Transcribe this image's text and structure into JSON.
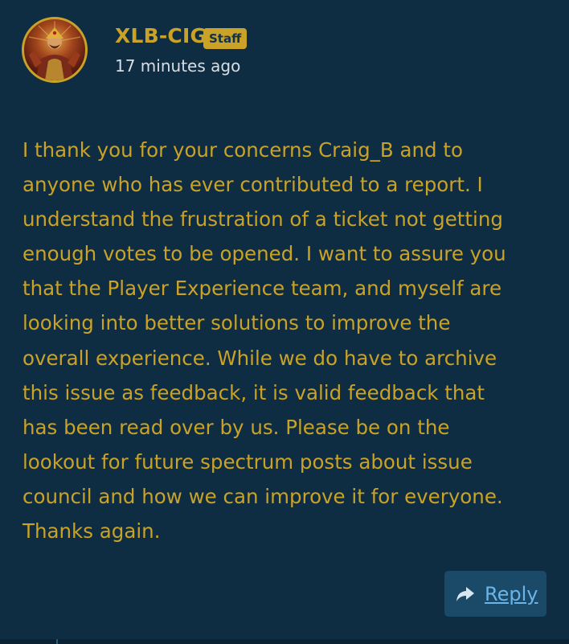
{
  "post": {
    "author": "XLB-CIG",
    "badge": "Staff",
    "timestamp": "17 minutes ago",
    "avatar_icon": "character-portrait-avatar",
    "body_lines": [
      "I thank you for your concerns Craig_B and to",
      "anyone who has ever contributed to a report. I",
      "understand the frustration of a ticket not getting",
      "enough votes to be opened. I want to assure you",
      "that the Player Experience team, and myself are",
      "looking into better solutions to improve the",
      "overall experience. While we do have to archive",
      "this issue as feedback, it is valid feedback that",
      "has been read over by us. Please be on the",
      "lookout for future spectrum posts about issue",
      "council and how we can improve it for everyone.",
      "Thanks again."
    ]
  },
  "actions": {
    "reply_label": "Reply",
    "reply_icon": "reply-arrow-icon"
  },
  "colors": {
    "background": "#0f2d42",
    "accent_gold": "#c9a227",
    "link_blue": "#6ab4e8",
    "button_bg": "#1a4a68"
  }
}
